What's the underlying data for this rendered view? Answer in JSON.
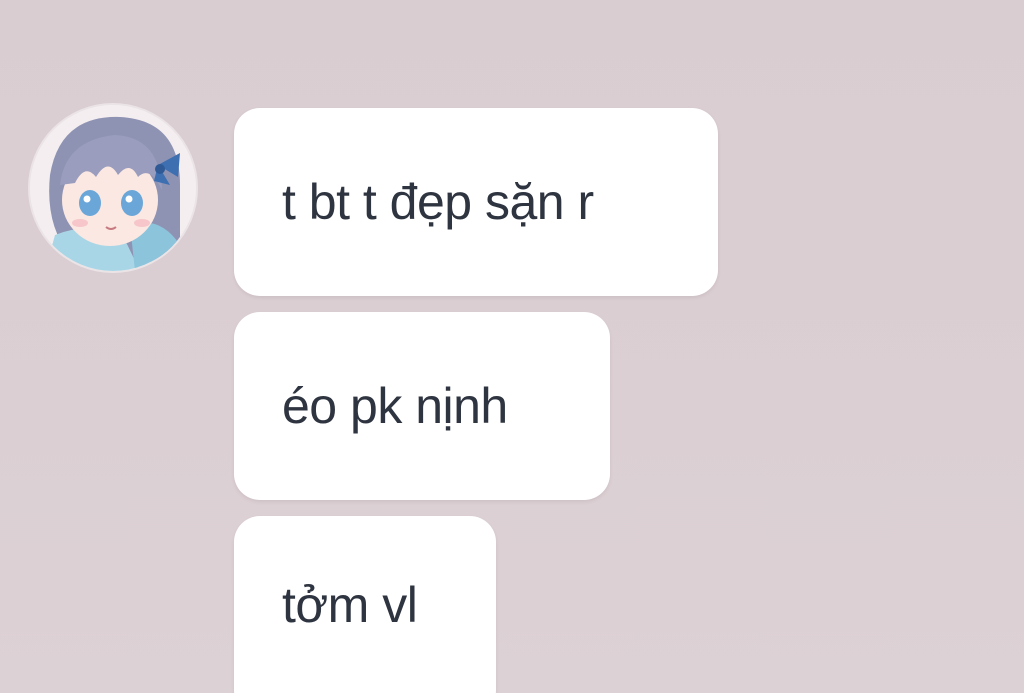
{
  "chat": {
    "sender": {
      "avatar_icon": "anime-girl-avatar-icon"
    },
    "messages": [
      {
        "text": "t bt t đẹp sặn r"
      },
      {
        "text": "éo pk nịnh"
      },
      {
        "text": "tởm vl"
      }
    ]
  },
  "colors": {
    "background": "#dcd0d3",
    "bubble": "#ffffff",
    "text": "#2e3440"
  }
}
